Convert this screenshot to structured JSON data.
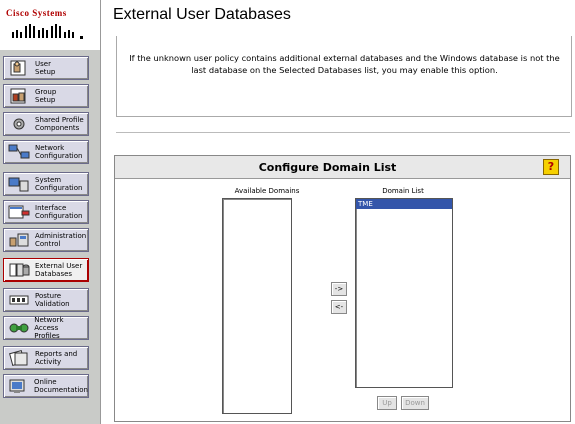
{
  "brand": {
    "name": "Cisco Systems"
  },
  "sidebar": {
    "items": [
      {
        "label": "User\nSetup",
        "icon": "user-setup-icon"
      },
      {
        "label": "Group\nSetup",
        "icon": "group-setup-icon"
      },
      {
        "label": "Shared Profile\nComponents",
        "icon": "shared-profile-icon"
      },
      {
        "label": "Network\nConfiguration",
        "icon": "network-config-icon"
      },
      {
        "label": "System\nConfiguration",
        "icon": "system-config-icon"
      },
      {
        "label": "Interface\nConfiguration",
        "icon": "interface-config-icon"
      },
      {
        "label": "Administration\nControl",
        "icon": "admin-control-icon"
      },
      {
        "label": "External User\nDatabases",
        "icon": "external-db-icon"
      },
      {
        "label": "Posture\nValidation",
        "icon": "posture-validation-icon"
      },
      {
        "label": "Network Access\nProfiles",
        "icon": "network-access-profiles-icon"
      },
      {
        "label": "Reports and\nActivity",
        "icon": "reports-icon"
      },
      {
        "label": "Online\nDocumentation",
        "icon": "documentation-icon"
      }
    ]
  },
  "page": {
    "title": "External User Databases",
    "info_text": "If the unknown user policy contains additional external databases and the Windows database is not the last database on the Selected Databases list, you may enable this option."
  },
  "panel": {
    "title": "Configure Domain List",
    "help_label": "?",
    "available_label": "Available Domains",
    "domain_list_label": "Domain List",
    "available_items": [],
    "domain_items": [
      "TME"
    ],
    "move_right_label": "->",
    "move_left_label": "<-",
    "up_label": "Up",
    "down_label": "Down"
  }
}
